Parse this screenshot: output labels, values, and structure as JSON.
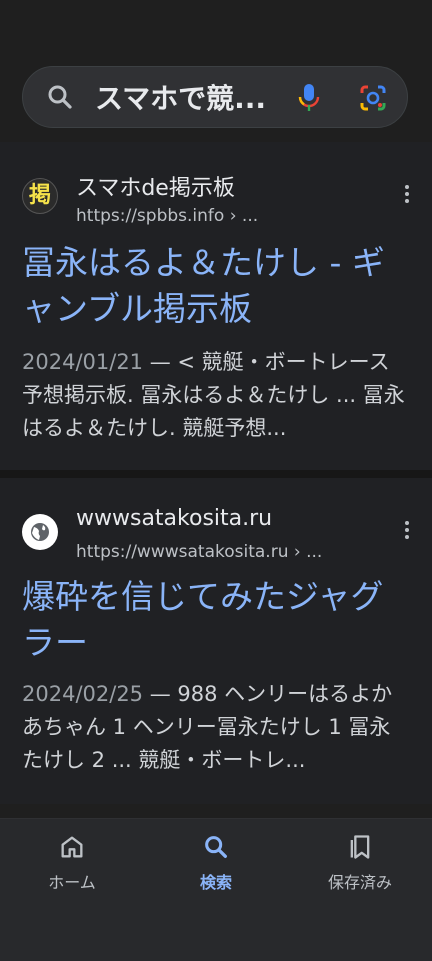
{
  "search": {
    "query": "スマホで競...",
    "icons": {
      "search": "search-icon",
      "mic": "mic-icon",
      "lens": "lens-icon"
    }
  },
  "results": [
    {
      "site_name": "スマホde掲示板",
      "url": "https://spbbs.info › ...",
      "favicon_text": "掲",
      "title": "冨永はるよ＆たけし - ギャンブル掲示板",
      "date": "2024/01/21",
      "snippet": "< 競艇・ボートレース予想掲示板. 冨永はるよ＆たけし ... 冨永はるよ＆たけし. 競艇予想..."
    },
    {
      "site_name": "wwwsatakosita.ru",
      "url": "https://wwwsatakosita.ru › ...",
      "favicon_icon": "globe-icon",
      "title": "爆砕を信じてみたジャグラー",
      "date": "2024/02/25",
      "snippet": "988 ヘンリーはるよかあちゃん 1 ヘンリー冨永たけし 1 冨永たけし 2 ... 競艇・ボートレ..."
    }
  ],
  "bottom_nav": {
    "home": "ホーム",
    "search": "検索",
    "saved": "保存済み"
  },
  "colors": {
    "background": "#1f1f1f",
    "card": "#202124",
    "link": "#8ab4f8",
    "text": "#e8eaed"
  }
}
